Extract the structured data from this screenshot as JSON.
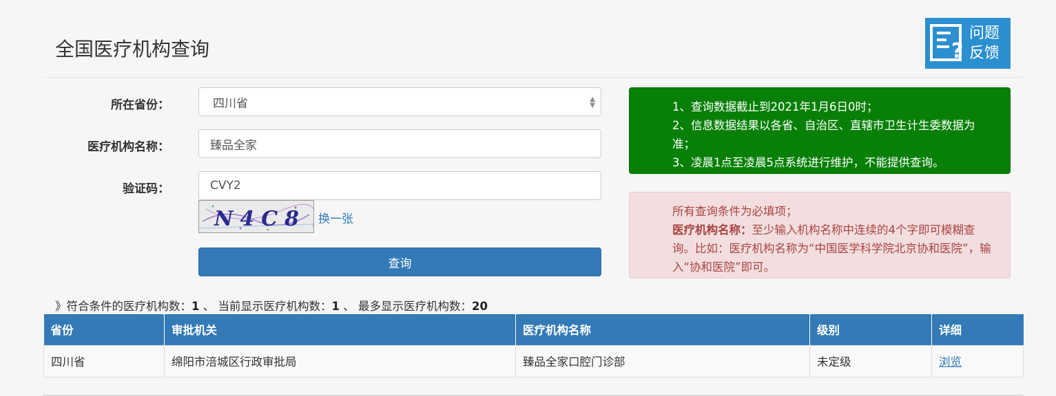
{
  "page": {
    "title": "全国医疗机构查询"
  },
  "feedback": {
    "label": "问题反馈"
  },
  "form": {
    "province_label": "所在省份：",
    "province_value": "四川省",
    "name_label": "医疗机构名称：",
    "name_value": "臻品全家",
    "captcha_label": "验证码：",
    "captcha_value": "CVY2",
    "captcha_image_text": "N4C8",
    "refresh_label": "换一张",
    "submit_label": "查询"
  },
  "notice_info": {
    "line1": "1、查询数据截止到2021年1月6日0时；",
    "line2": "2、信息数据结果以各省、自治区、直辖市卫生计生委数据为准；",
    "line3": "3、凌晨1点至凌晨5点系统进行维护，不能提供查询。"
  },
  "notice_rules": {
    "line1": "所有查询条件为必填项；",
    "bold_label": "医疗机构名称：",
    "rest": "至少输入机构名称中连续的4个字即可模糊查询。比如：医疗机构名称为“中国医学科学院北京协和医院”，输入“协和医院”即可。"
  },
  "summary": {
    "prefix": "》符合条件的医疗机构数：",
    "matched_count": "1",
    "sep1": " 、 当前显示医疗机构数：",
    "shown_count": "1",
    "sep2": " 、 最多显示医疗机构数：",
    "max_count": "20"
  },
  "table": {
    "headers": [
      "省份",
      "审批机关",
      "医疗机构名称",
      "级别",
      "详细"
    ],
    "rows": [
      {
        "province": "四川省",
        "authority": "绵阳市涪城区行政审批局",
        "name": "臻品全家口腔门诊部",
        "level": "未定级",
        "detail": "浏览"
      }
    ]
  },
  "colors": {
    "primary": "#337ab7",
    "notice_green": "#088008",
    "notice_red_bg": "#f2dede",
    "notice_red_text": "#a94442"
  }
}
